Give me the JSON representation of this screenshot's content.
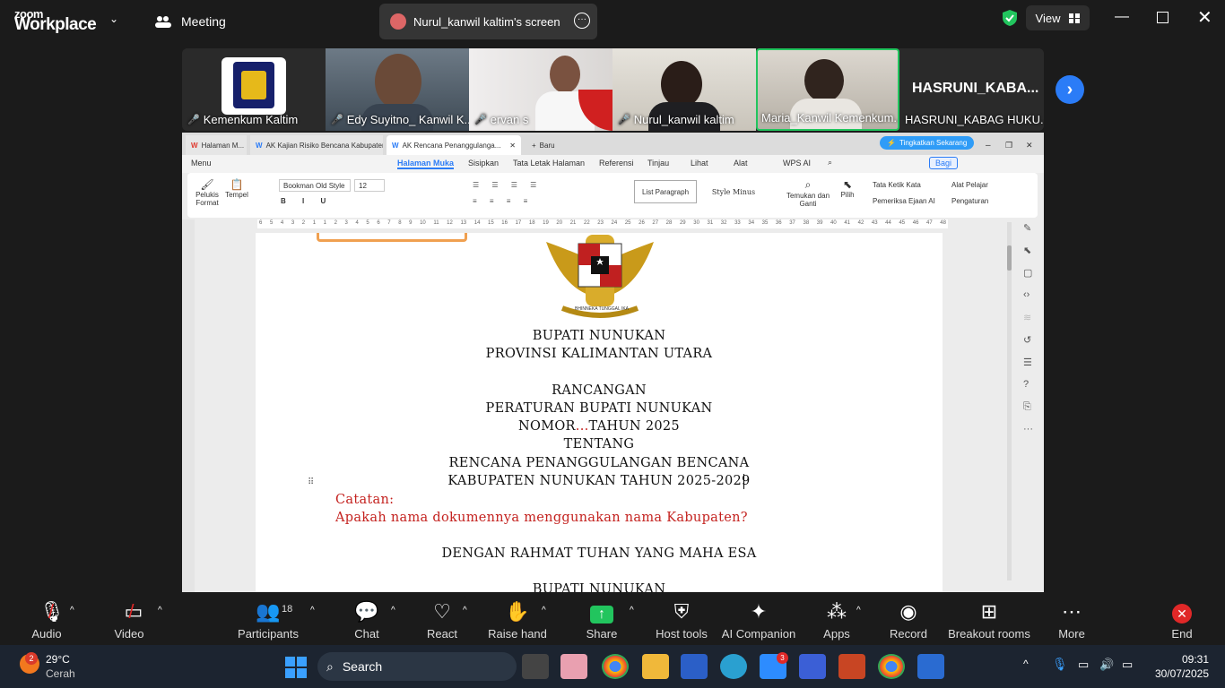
{
  "zoom": {
    "logo_top": "zoom",
    "logo_bottom": "Workplace",
    "meeting_label": "Meeting",
    "share_tab": "Nurul_kanwil kaltim's screen",
    "view_label": "View"
  },
  "participants": [
    {
      "name": "Kemenkum Kaltim"
    },
    {
      "name": "Edy Suyitno_ Kanwil K..."
    },
    {
      "name": "ervan s"
    },
    {
      "name": "Nurul_kanwil kaltim"
    },
    {
      "name": "Maria_Kanwil Kemenkum..."
    },
    {
      "name": "HASRUNI_KABAG HUKU...",
      "avatar": "HASRUNI_KABA..."
    }
  ],
  "wps": {
    "tabs": [
      "Halaman M...",
      "AK Kajian Risiko Bencana Kabupaten",
      "AK Rencana Penanggulanga..."
    ],
    "new_tab": "Baru",
    "upgrade": "Tingkatkan Sekarang",
    "menu": [
      "Menu",
      "Halaman Muka",
      "Sisipkan",
      "Tata Letak Halaman",
      "Referensi",
      "Tinjau",
      "Lihat",
      "Alat",
      "WPS AI"
    ],
    "share": "Bagi",
    "font": "Bookman Old Style",
    "size": "12",
    "ribbon": {
      "pelukis": "Pelukis Format",
      "tempel": "Tempel",
      "list_style": "List Paragraph",
      "style_minus": "Style Minus",
      "find": "Temukan dan Ganti",
      "pilih": "Pilih",
      "tata_ketik": "Tata Ketik Kata",
      "alat_pelajar": "Alat Pelajar",
      "pemeriksa": "Pemeriksa Ejaan AI",
      "pengaturan": "Pengaturan"
    },
    "ruler": [
      "6",
      "5",
      "4",
      "3",
      "2",
      "1",
      "1",
      "2",
      "3",
      "4",
      "5",
      "6",
      "7",
      "8",
      "9",
      "10",
      "11",
      "12",
      "13",
      "14",
      "15",
      "16",
      "17",
      "18",
      "19",
      "20",
      "21",
      "22",
      "23",
      "24",
      "25",
      "26",
      "27",
      "28",
      "29",
      "30",
      "31",
      "32",
      "33",
      "34",
      "35",
      "36",
      "37",
      "38",
      "39",
      "40",
      "41",
      "42",
      "43",
      "44",
      "45",
      "46",
      "47",
      "48"
    ]
  },
  "document": {
    "l1": "BUPATI NUNUKAN",
    "l2": "PROVINSI KALIMANTAN UTARA",
    "l3": "RANCANGAN",
    "l4": "PERATURAN BUPATI NUNUKAN",
    "l5a": "NOMOR",
    "l5b": "...",
    "l5c": "TAHUN 2025",
    "l6": "TENTANG",
    "l7": "RENCANA PENANGGULANGAN BENCANA",
    "l8": "KABUPATEN NUNUKAN TAHUN 2025-2029",
    "note_title": "Catatan:",
    "note_body": "Apakah nama dokumennya menggunakan nama Kabupaten?",
    "l9": "DENGAN RAHMAT TUHAN YANG MAHA ESA",
    "l10": "BUPATI NUNUKAN",
    "emblem_text": "BHINNEKA TUNGGAL IKA"
  },
  "controls": {
    "audio": "Audio",
    "video": "Video",
    "participants": "Participants",
    "participants_count": "18",
    "chat": "Chat",
    "react": "React",
    "raise": "Raise hand",
    "share": "Share",
    "host": "Host tools",
    "ai": "AI Companion",
    "apps": "Apps",
    "record": "Record",
    "breakout": "Breakout rooms",
    "more": "More",
    "end": "End"
  },
  "taskbar": {
    "weather_temp": "29°C",
    "weather_desc": "Cerah",
    "weather_badge": "2",
    "search": "Search",
    "zoom_badge": "3",
    "time": "09:31",
    "date": "30/07/2025"
  },
  "colors": {
    "zoom_green": "#22c55e",
    "zoom_red": "#e02828",
    "doc_red": "#c4221f",
    "wps_blue": "#2b7cf7"
  }
}
